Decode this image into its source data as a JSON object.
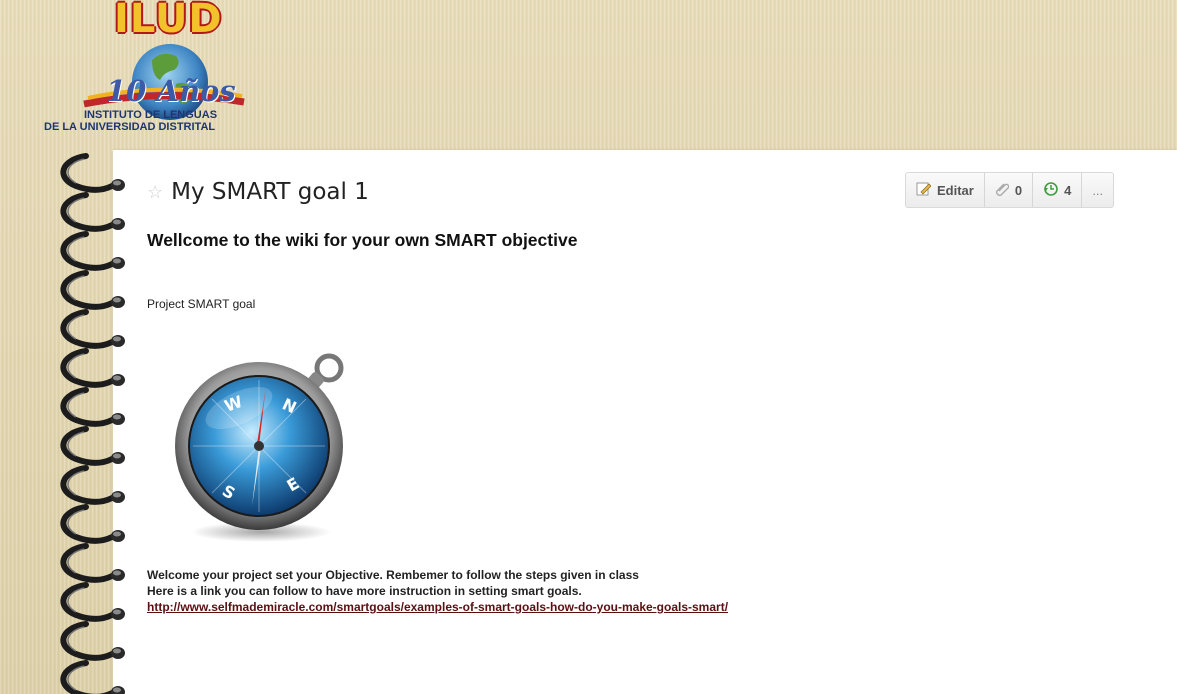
{
  "logo": {
    "top_text": "ILUD",
    "anos_text": "10 Años",
    "line1": "INSTITUTO DE LENGUAS",
    "line2": "DE LA UNIVERSIDAD DISTRITAL"
  },
  "page": {
    "title": "My SMART goal 1",
    "heading": "Wellcome to the wiki for your own SMART objective",
    "subheading": "Project SMART goal",
    "body_line1": "Welcome your project set your Objective. Rembemer to follow the steps given in class",
    "body_line2": "Here is a link you can follow to have more instruction in setting smart goals.",
    "link_text": "http://www.selfmademiracle.com/smartgoals/examples-of-smart-goals-how-do-you-make-goals-smart/"
  },
  "toolbar": {
    "edit_label": "Editar",
    "comments_count": "0",
    "revisions_count": "4",
    "more_label": "..."
  },
  "colors": {
    "accent_link": "#5a1012",
    "background": "#e3d6ae",
    "paper": "#ffffff"
  }
}
